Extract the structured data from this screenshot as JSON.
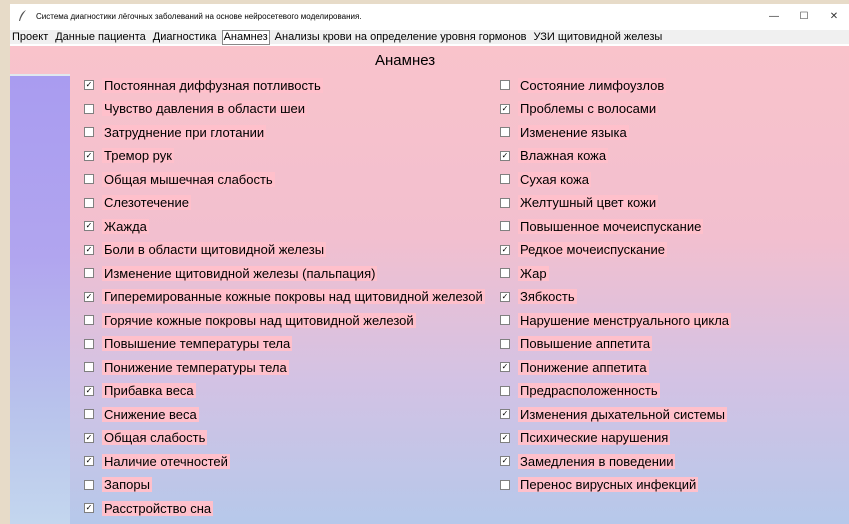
{
  "window": {
    "title": "Система диагностики лёгочных заболеваний на основе нейросетевого моделирования."
  },
  "controls": {
    "minimize": "—",
    "maximize": "☐",
    "close": "✕"
  },
  "tabs": [
    {
      "label": "Проект",
      "active": false
    },
    {
      "label": "Данные пациента",
      "active": false
    },
    {
      "label": "Диагностика",
      "active": false
    },
    {
      "label": "Анамнез",
      "active": true
    },
    {
      "label": "Анализы крови на определение уровня гормонов",
      "active": false
    },
    {
      "label": "УЗИ щитовидной железы",
      "active": false
    }
  ],
  "section_title": "Анамнез",
  "left_items": [
    {
      "label": "Постоянная диффузная потливость",
      "checked": true
    },
    {
      "label": "Чувство давления в области шеи",
      "checked": false
    },
    {
      "label": "Затруднение при глотании",
      "checked": false
    },
    {
      "label": "Тремор рук",
      "checked": true
    },
    {
      "label": "Общая мышечная слабость",
      "checked": false
    },
    {
      "label": "Слезотечение",
      "checked": false
    },
    {
      "label": "Жажда",
      "checked": true
    },
    {
      "label": "Боли в области щитовидной железы",
      "checked": true
    },
    {
      "label": "Изменение щитовидной железы (пальпация)",
      "checked": false
    },
    {
      "label": "Гиперемированные кожные покровы над щитовидной железой",
      "checked": true
    },
    {
      "label": "Горячие кожные покровы над щитовидной железой",
      "checked": false
    },
    {
      "label": "Повышение температуры тела",
      "checked": false
    },
    {
      "label": "Понижение температуры тела",
      "checked": false
    },
    {
      "label": "Прибавка веса",
      "checked": true
    },
    {
      "label": "Снижение веса",
      "checked": false
    },
    {
      "label": "Общая слабость",
      "checked": true
    },
    {
      "label": "Наличие отечностей",
      "checked": true
    },
    {
      "label": "Запоры",
      "checked": false
    },
    {
      "label": "Расстройство сна",
      "checked": true
    }
  ],
  "right_items": [
    {
      "label": "Состояние лимфоузлов",
      "checked": false
    },
    {
      "label": "Проблемы с волосами",
      "checked": true
    },
    {
      "label": "Изменение языка",
      "checked": false
    },
    {
      "label": "Влажная кожа",
      "checked": true
    },
    {
      "label": "Сухая кожа",
      "checked": false
    },
    {
      "label": "Желтушный цвет кожи",
      "checked": false
    },
    {
      "label": "Повышенное мочеиспускание",
      "checked": false
    },
    {
      "label": "Редкое мочеиспускание",
      "checked": true
    },
    {
      "label": "Жар",
      "checked": false
    },
    {
      "label": "Зябкость",
      "checked": true
    },
    {
      "label": "Нарушение менструального цикла",
      "checked": false
    },
    {
      "label": "Повышение аппетита",
      "checked": false
    },
    {
      "label": "Понижение аппетита",
      "checked": true
    },
    {
      "label": "Предрасположенность",
      "checked": false
    },
    {
      "label": "Изменения дыхательной системы",
      "checked": true
    },
    {
      "label": "Психические нарушения",
      "checked": true
    },
    {
      "label": "Замедления в поведении",
      "checked": true
    },
    {
      "label": "Перенос вирусных инфекций",
      "checked": false
    }
  ]
}
